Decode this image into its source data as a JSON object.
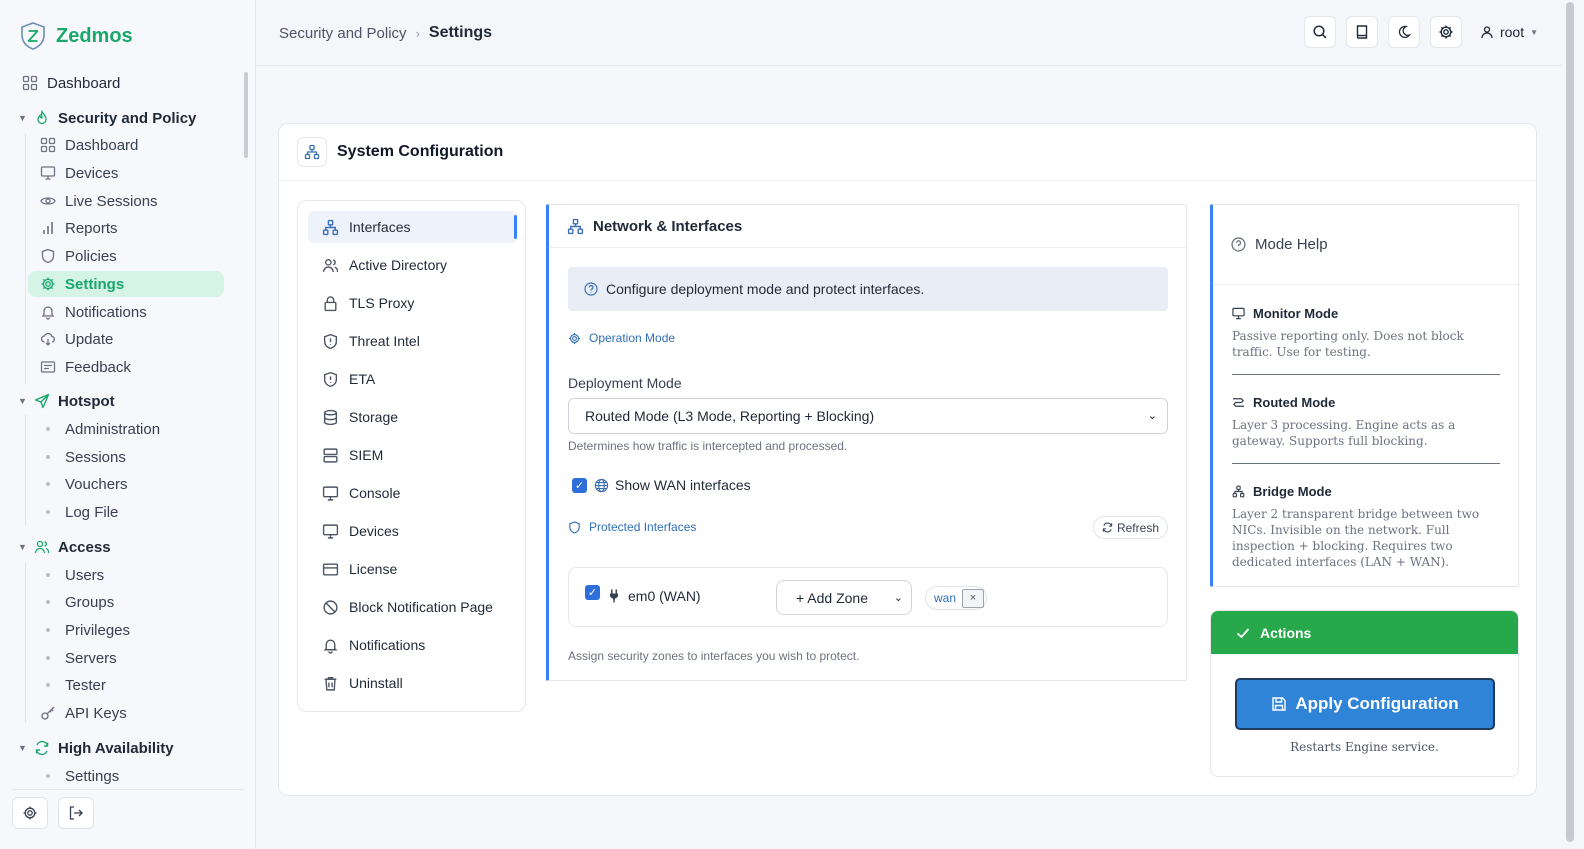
{
  "app": {
    "name": "Zedmos"
  },
  "sidebar": {
    "top": [
      {
        "label": "Dashboard",
        "icon": "grid-icon"
      }
    ],
    "groups": [
      {
        "label": "Security and Policy",
        "icon": "flame-icon",
        "items": [
          {
            "label": "Dashboard",
            "icon": "grid-icon"
          },
          {
            "label": "Devices",
            "icon": "monitor-icon"
          },
          {
            "label": "Live Sessions",
            "icon": "eye-icon"
          },
          {
            "label": "Reports",
            "icon": "bar-chart-icon"
          },
          {
            "label": "Policies",
            "icon": "shield-icon"
          },
          {
            "label": "Settings",
            "icon": "gear-icon",
            "active": true
          },
          {
            "label": "Notifications",
            "icon": "bell-icon"
          },
          {
            "label": "Update",
            "icon": "cloud-download-icon"
          },
          {
            "label": "Feedback",
            "icon": "feedback-icon"
          }
        ]
      },
      {
        "label": "Hotspot",
        "icon": "send-icon",
        "items": [
          {
            "label": "Administration"
          },
          {
            "label": "Sessions"
          },
          {
            "label": "Vouchers"
          },
          {
            "label": "Log File"
          }
        ]
      },
      {
        "label": "Access",
        "icon": "users-icon",
        "items": [
          {
            "label": "Users"
          },
          {
            "label": "Groups"
          },
          {
            "label": "Privileges"
          },
          {
            "label": "Servers"
          },
          {
            "label": "Tester"
          },
          {
            "label": "API Keys",
            "icon": "key-icon"
          }
        ]
      },
      {
        "label": "High Availability",
        "icon": "refresh-icon",
        "items": [
          {
            "label": "Settings"
          }
        ]
      }
    ]
  },
  "header": {
    "breadcrumb": [
      "Security and Policy",
      "Settings"
    ],
    "user": "root"
  },
  "card": {
    "title": "System Configuration"
  },
  "menu": [
    {
      "label": "Interfaces",
      "icon": "network-icon",
      "selected": true
    },
    {
      "label": "Active Directory",
      "icon": "users-icon"
    },
    {
      "label": "TLS Proxy",
      "icon": "lock-icon"
    },
    {
      "label": "Threat Intel",
      "icon": "shield-alert-icon"
    },
    {
      "label": "ETA",
      "icon": "shield-alert-icon"
    },
    {
      "label": "Storage",
      "icon": "database-icon"
    },
    {
      "label": "SIEM",
      "icon": "server-icon"
    },
    {
      "label": "Console",
      "icon": "monitor-icon"
    },
    {
      "label": "Devices",
      "icon": "monitor-icon"
    },
    {
      "label": "License",
      "icon": "card-icon"
    },
    {
      "label": "Block Notification Page",
      "icon": "ban-icon"
    },
    {
      "label": "Notifications",
      "icon": "bell-icon"
    },
    {
      "label": "Uninstall",
      "icon": "trash-icon"
    }
  ],
  "network": {
    "title": "Network & Interfaces",
    "info": "Configure deployment mode and protect interfaces.",
    "operation_mode_label": "Operation Mode",
    "deployment_label": "Deployment Mode",
    "deployment_value": "Routed Mode (L3 Mode, Reporting + Blocking)",
    "deployment_hint": "Determines how traffic is intercepted and processed.",
    "show_wan_label": "Show WAN interfaces",
    "show_wan_checked": true,
    "protected_label": "Protected Interfaces",
    "refresh_label": "Refresh",
    "interface": {
      "name": "em0 (WAN)",
      "checked": true,
      "zone_select": "+ Add Zone",
      "tag": "wan",
      "tag_remove": "×"
    },
    "assign_hint": "Assign security zones to interfaces you wish to protect."
  },
  "help": {
    "title": "Mode Help",
    "modes": [
      {
        "title": "Monitor Mode",
        "icon": "monitor-icon",
        "desc": "Passive reporting only. Does not block traffic. Use for testing."
      },
      {
        "title": "Routed Mode",
        "icon": "route-icon",
        "desc": "Layer 3 processing. Engine acts as a gateway. Supports full blocking."
      },
      {
        "title": "Bridge Mode",
        "icon": "network-icon",
        "desc": "Layer 2 transparent bridge between two NICs. Invisible on the network. Full inspection + blocking. Requires two dedicated interfaces (LAN + WAN)."
      }
    ]
  },
  "actions": {
    "title": "Actions",
    "apply_label": "Apply Configuration",
    "apply_hint": "Restarts Engine service."
  },
  "colors": {
    "brand": "#1aa76a",
    "accent": "#3b82f6",
    "success": "#27a84a",
    "apply": "#2f84d8"
  }
}
